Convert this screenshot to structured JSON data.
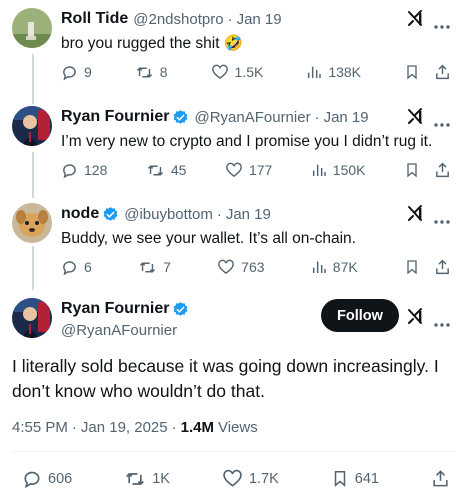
{
  "tweets": [
    {
      "display_name": "Roll Tide",
      "handle": "@2ndshotpro",
      "date": "Jan 19",
      "text": "bro you rugged the shit 🤣",
      "replies": "9",
      "reposts": "8",
      "likes": "1.5K",
      "views": "138K"
    },
    {
      "display_name": "Ryan Fournier",
      "handle": "@RyanAFournier",
      "date": "Jan 19",
      "text": "I’m very new to crypto and I promise you I didn’t rug it.",
      "replies": "128",
      "reposts": "45",
      "likes": "177",
      "views": "150K"
    },
    {
      "display_name": "node",
      "handle": "@ibuybottom",
      "date": "Jan 19",
      "text": "Buddy, we see your wallet. It’s all on-chain.",
      "replies": "6",
      "reposts": "7",
      "likes": "763",
      "views": "87K"
    }
  ],
  "main_tweet": {
    "display_name": "Ryan Fournier",
    "handle": "@RyanAFournier",
    "follow_label": "Follow",
    "text_line1": "I literally sold because it was going down increasingly. I",
    "text_line2": "don’t know who wouldn’t do that.",
    "time": "4:55 PM",
    "date": "Jan 19, 2025",
    "views_count": "1.4M",
    "views_label": "Views",
    "replies": "606",
    "reposts": "1K",
    "likes": "1.7K",
    "bookmarks": "641"
  },
  "colors": {
    "verified": "#1d9bf0",
    "muted": "#536471",
    "text": "#0f1419"
  },
  "icons": [
    "grok-icon",
    "more-icon",
    "reply-icon",
    "repost-icon",
    "like-icon",
    "views-icon",
    "bookmark-icon",
    "share-icon"
  ]
}
